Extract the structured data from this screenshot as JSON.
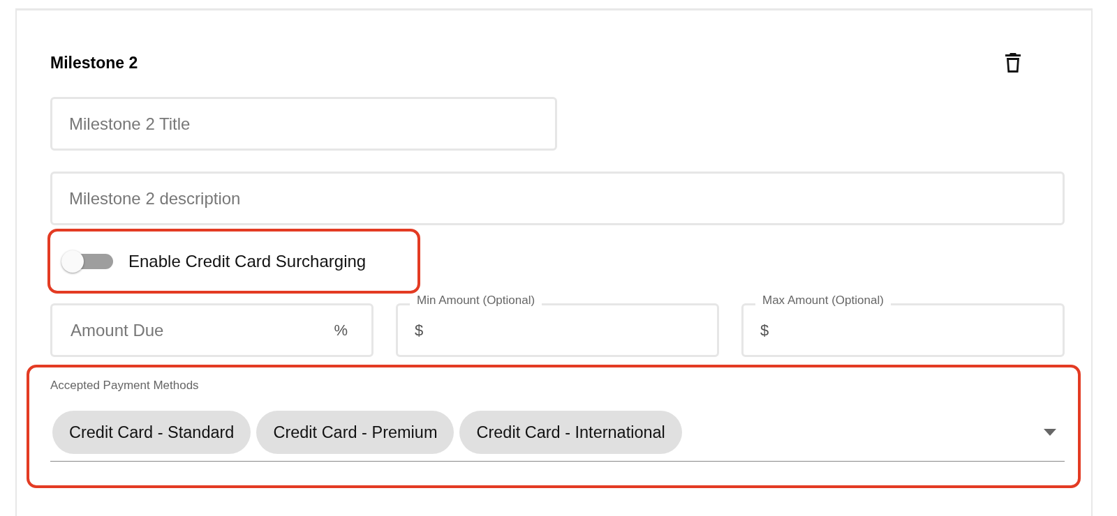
{
  "milestone": {
    "title": "Milestone 2"
  },
  "fields": [
    {
      "kind": "title",
      "placeholder": "Milestone 2 Title"
    },
    {
      "kind": "description",
      "placeholder": "Milestone 2 description"
    }
  ],
  "surcharge_toggle": {
    "label": "Enable Credit Card Surcharging",
    "on": false,
    "highlighted": true
  },
  "amounts": [
    {
      "placeholder": "Amount Due",
      "suffix": "%"
    },
    {
      "label": "Min Amount (Optional)",
      "prefix": "$"
    },
    {
      "label": "Max Amount (Optional)",
      "prefix": "$"
    }
  ],
  "payment_methods": {
    "label": "Accepted Payment Methods",
    "highlighted": true,
    "chips": [
      {
        "label": "Credit Card - Standard"
      },
      {
        "label": "Credit Card - Premium"
      },
      {
        "label": "Credit Card - International"
      }
    ]
  }
}
